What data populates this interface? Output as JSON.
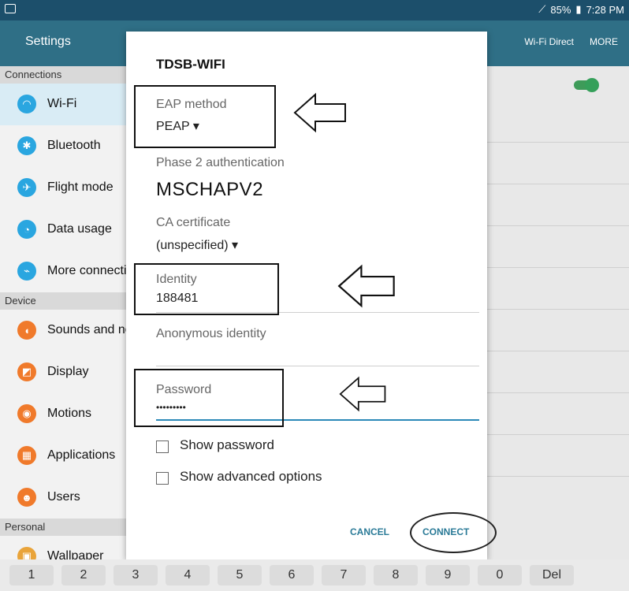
{
  "status_bar": {
    "battery": "85%",
    "time": "7:28 PM"
  },
  "app_bar": {
    "title": "Settings",
    "actions": [
      "Wi-Fi Direct",
      "MORE"
    ]
  },
  "left_list": {
    "sections": [
      {
        "label": "Connections",
        "items": [
          "Wi-Fi",
          "Bluetooth",
          "Flight mode",
          "Data usage",
          "More connection settings"
        ]
      },
      {
        "label": "Device",
        "items": [
          "Sounds and notifications",
          "Display",
          "Motions",
          "Applications",
          "Users"
        ]
      },
      {
        "label": "Personal",
        "items": [
          "Wallpaper"
        ]
      }
    ]
  },
  "dialog": {
    "title": "TDSB-WIFI",
    "eap": {
      "label": "EAP method",
      "value": "PEAP ▾"
    },
    "phase2": {
      "label": "Phase 2 authentication",
      "value": "MSCHAPV2"
    },
    "ca": {
      "label": "CA certificate",
      "value": "(unspecified) ▾"
    },
    "identity": {
      "label": "Identity",
      "value": "188481"
    },
    "anonymous": {
      "label": "Anonymous identity"
    },
    "password": {
      "label": "Password",
      "value": "•••••••••"
    },
    "checkboxes": [
      "Show password",
      "Show advanced options"
    ],
    "buttons": {
      "cancel": "CANCEL",
      "connect": "CONNECT"
    }
  },
  "keyboard": {
    "keys": [
      "1",
      "2",
      "3",
      "4",
      "5",
      "6",
      "7",
      "8",
      "9",
      "0",
      "Del"
    ]
  },
  "colors": {
    "appbar": "#2f6f86",
    "statusbar": "#1c4f6b",
    "accent": "#2b89b8"
  }
}
